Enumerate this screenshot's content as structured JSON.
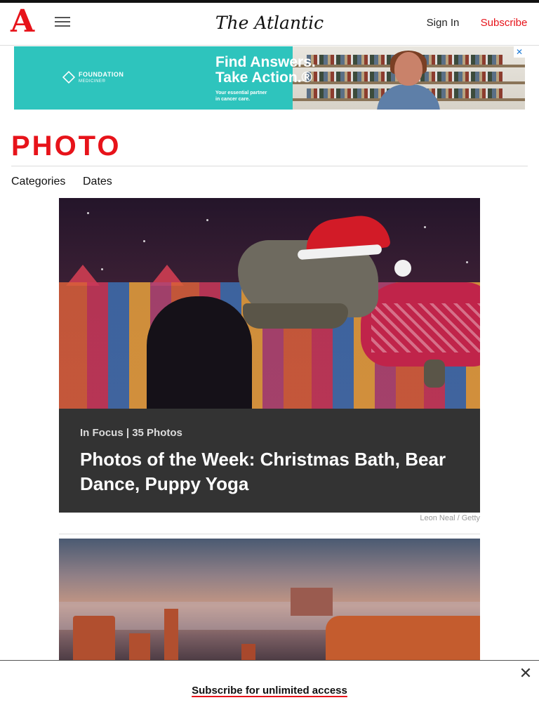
{
  "header": {
    "logo_letter": "A",
    "wordmark": "The Atlantic",
    "sign_in": "Sign In",
    "subscribe": "Subscribe"
  },
  "ad": {
    "brand_name": "FOUNDATION",
    "brand_sub": "MEDICINE®",
    "headline": "Find Answers.\nTake Action.®",
    "tagline": "Your essential partner\nin cancer care.",
    "close_label": "✕"
  },
  "section": {
    "title": "PHOTO",
    "filters": [
      "Categories",
      "Dates"
    ]
  },
  "feature": {
    "kicker": "In Focus | 35 Photos",
    "title": "Photos of the Week: Christmas Bath, Bear Dance, Puppy Yoga",
    "credit": "Leon Neal / Getty"
  },
  "subscribe_bar": {
    "link": "Subscribe for unlimited access",
    "close_label": "✕"
  },
  "colors": {
    "brand_red": "#e7131a",
    "ad_teal": "#2ec4bd",
    "panel_dark": "#333333"
  },
  "icons": [
    "menu-icon",
    "close-icon",
    "ad-close-icon"
  ]
}
